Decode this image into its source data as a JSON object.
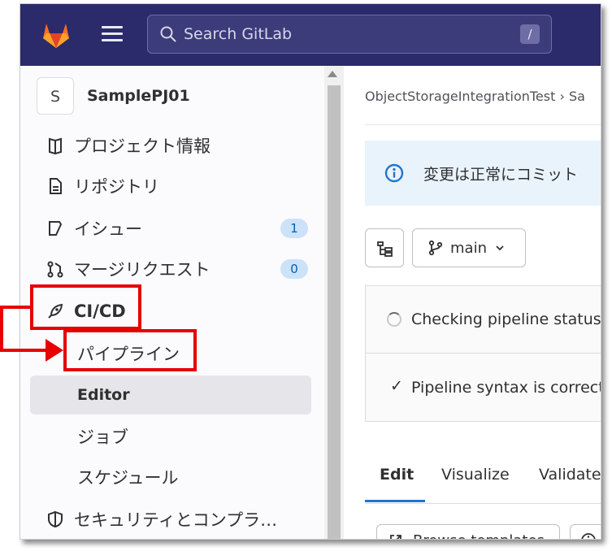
{
  "topbar": {
    "search_placeholder": "Search GitLab",
    "search_shortcut": "/",
    "icons": [
      "gitlab-logo",
      "hamburger-icon",
      "search-icon"
    ]
  },
  "sidebar": {
    "project_avatar_letter": "S",
    "project_name": "SamplePJ01",
    "items": [
      {
        "label": "プロジェクト情報",
        "icon": "project-info-icon"
      },
      {
        "label": "リポジトリ",
        "icon": "document-icon"
      },
      {
        "label": "イシュー",
        "icon": "issues-icon",
        "badge": "1"
      },
      {
        "label": "マージリクエスト",
        "icon": "merge-request-icon",
        "badge": "0"
      },
      {
        "label": "CI/CD",
        "icon": "rocket-icon"
      },
      {
        "label": "セキュリティとコンプラ…",
        "icon": "shield-icon"
      }
    ],
    "cicd_sub": [
      {
        "label": "パイプライン"
      },
      {
        "label": "Editor",
        "active": true
      },
      {
        "label": "ジョブ"
      },
      {
        "label": "スケジュール"
      }
    ]
  },
  "main": {
    "breadcrumb": "ObjectStorageIntegrationTest  ›  Sa",
    "alert_text": "変更は正常にコミット",
    "branch": "main",
    "pipeline_status": "Checking pipeline status",
    "syntax_status": "Pipeline syntax is correct",
    "tabs": [
      {
        "label": "Edit",
        "active": true
      },
      {
        "label": "Visualize"
      },
      {
        "label": "Validate"
      }
    ],
    "browse_templates": "Browse templates"
  },
  "colors": {
    "topbar": "#2b2a6a",
    "annotation_red": "#e60000",
    "badge_bg": "#cbe2f9",
    "active_tab_underline": "#1f75cb"
  }
}
